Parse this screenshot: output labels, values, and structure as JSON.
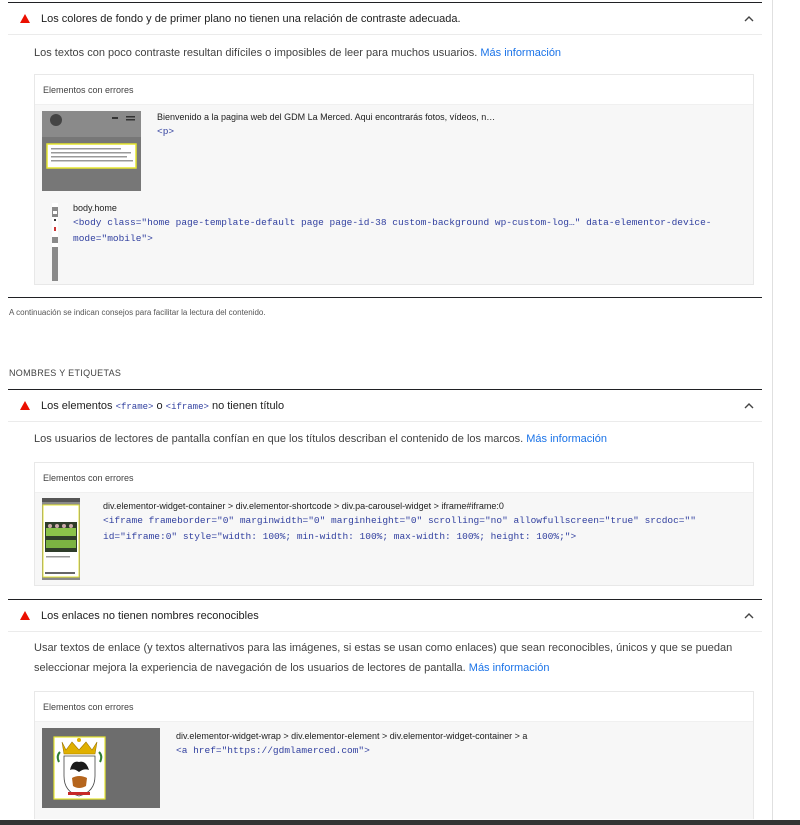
{
  "audits": [
    {
      "title": "Los colores de fondo y de primer plano no tienen una relación de contraste adecuada.",
      "description": "Los textos con poco contraste resultan difíciles o imposibles de leer para muchos usuarios.",
      "more_link": "Más información",
      "items_header": "Elementos con errores",
      "items": [
        {
          "path": "Bienvenido a la pagina web del GDM La Merced. Aqui encontrarás fotos, vídeos, n…",
          "code": "<p>"
        },
        {
          "path": "body.home",
          "code": "<body class=\"home page-template-default page page-id-38 custom-background wp-custom-log…\" data-elementor-device-mode=\"mobile\">"
        }
      ]
    },
    {
      "title_prefix": "Los elementos",
      "title_code1": "<frame>",
      "title_mid": "o",
      "title_code2": "<iframe>",
      "title_suffix": "no tienen título",
      "description": "Los usuarios de lectores de pantalla confían en que los títulos describan el contenido de los marcos.",
      "more_link": "Más información",
      "items_header": "Elementos con errores",
      "items": [
        {
          "path": "div.elementor-widget-container > div.elementor-shortcode > div.pa-carousel-widget > iframe#iframe:0",
          "code": "<iframe frameborder=\"0\" marginwidth=\"0\" marginheight=\"0\" scrolling=\"no\" allowfullscreen=\"true\" srcdoc=\"\" id=\"iframe:0\" style=\"width: 100%; min-width: 100%; max-width: 100%; height: 100%;\">"
        }
      ]
    },
    {
      "title": "Los enlaces no tienen nombres reconocibles",
      "description": "Usar textos de enlace (y textos alternativos para las imágenes, si estas se usan como enlaces) que sean reconocibles, únicos y que se puedan seleccionar mejora la experiencia de navegación de los usuarios de lectores de pantalla.",
      "more_link": "Más información",
      "items_header": "Elementos con errores",
      "items": [
        {
          "path": "div.elementor-widget-wrap > div.elementor-element > div.elementor-widget-container > a",
          "code": "<a href=\"https://gdmlamerced.com\">"
        }
      ]
    }
  ],
  "note": "A continuación se indican consejos para facilitar la lectura del contenido.",
  "section_title": "NOMBRES Y ETIQUETAS",
  "thumb1_text": "Bienvenido a la pagina web del GDM La Merced. Aqui encontrarás fotos, vídeos, noticias y toda la información del club",
  "colors": {
    "fail": "#eb0f00",
    "link": "#1a73e8",
    "code": "#303f9f"
  }
}
